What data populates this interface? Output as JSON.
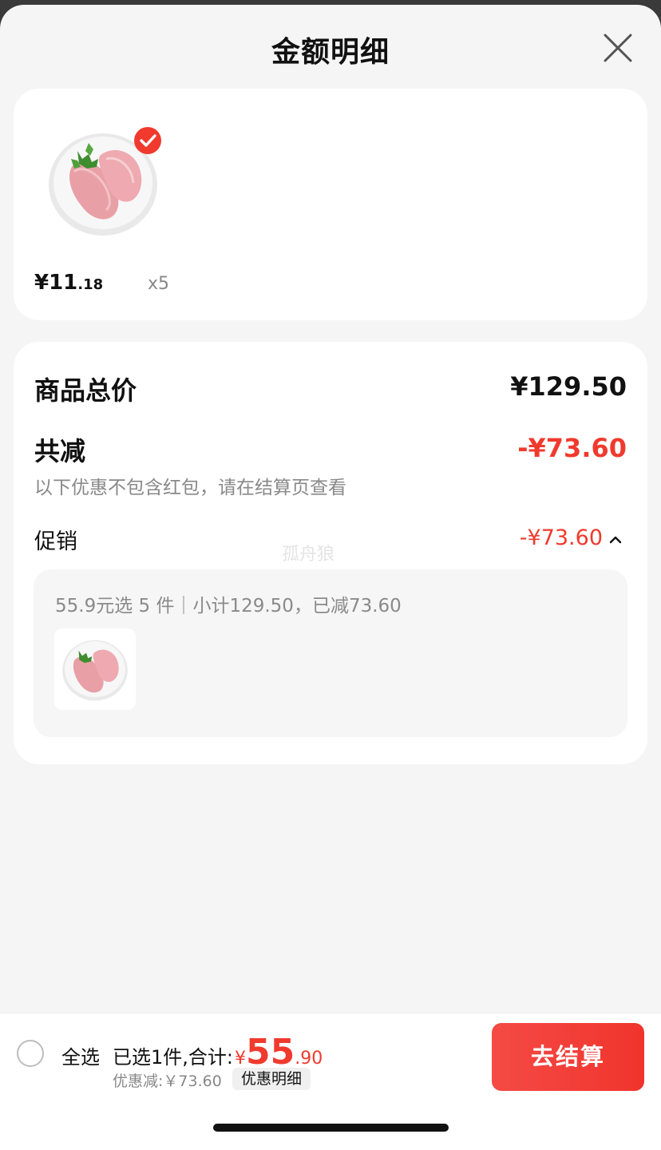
{
  "header": {
    "title": "金额明细",
    "close_icon": "close-icon"
  },
  "product": {
    "image_icon": "chicken-breast-image",
    "selected_icon": "check-circle-icon",
    "currency": "¥",
    "price_int": "11",
    "price_dec": ".18",
    "quantity": "x5"
  },
  "summary": {
    "total_label": "商品总价",
    "total_value": "¥129.50",
    "reduce_label": "共减",
    "reduce_value": "-¥73.60",
    "note": "以下优惠不包含红包，请在结算页查看",
    "promo_label": "促销",
    "promo_value": "-¥73.60",
    "watermark": "孤舟狼",
    "promo_desc": "55.9元选 5 件｜小计129.50，已减73.60"
  },
  "bottom_bar": {
    "select_all": "全选",
    "selected_text": "已选1件,合计:",
    "currency": "¥",
    "total_int": "55",
    "total_dec": ".90",
    "discount_text": "优惠减:￥73.60",
    "detail_chip": "优惠明细",
    "checkout_label": "去结算"
  },
  "colors": {
    "accent_red": "#f03a2e",
    "background": "#f5f5f5",
    "card": "#ffffff"
  }
}
